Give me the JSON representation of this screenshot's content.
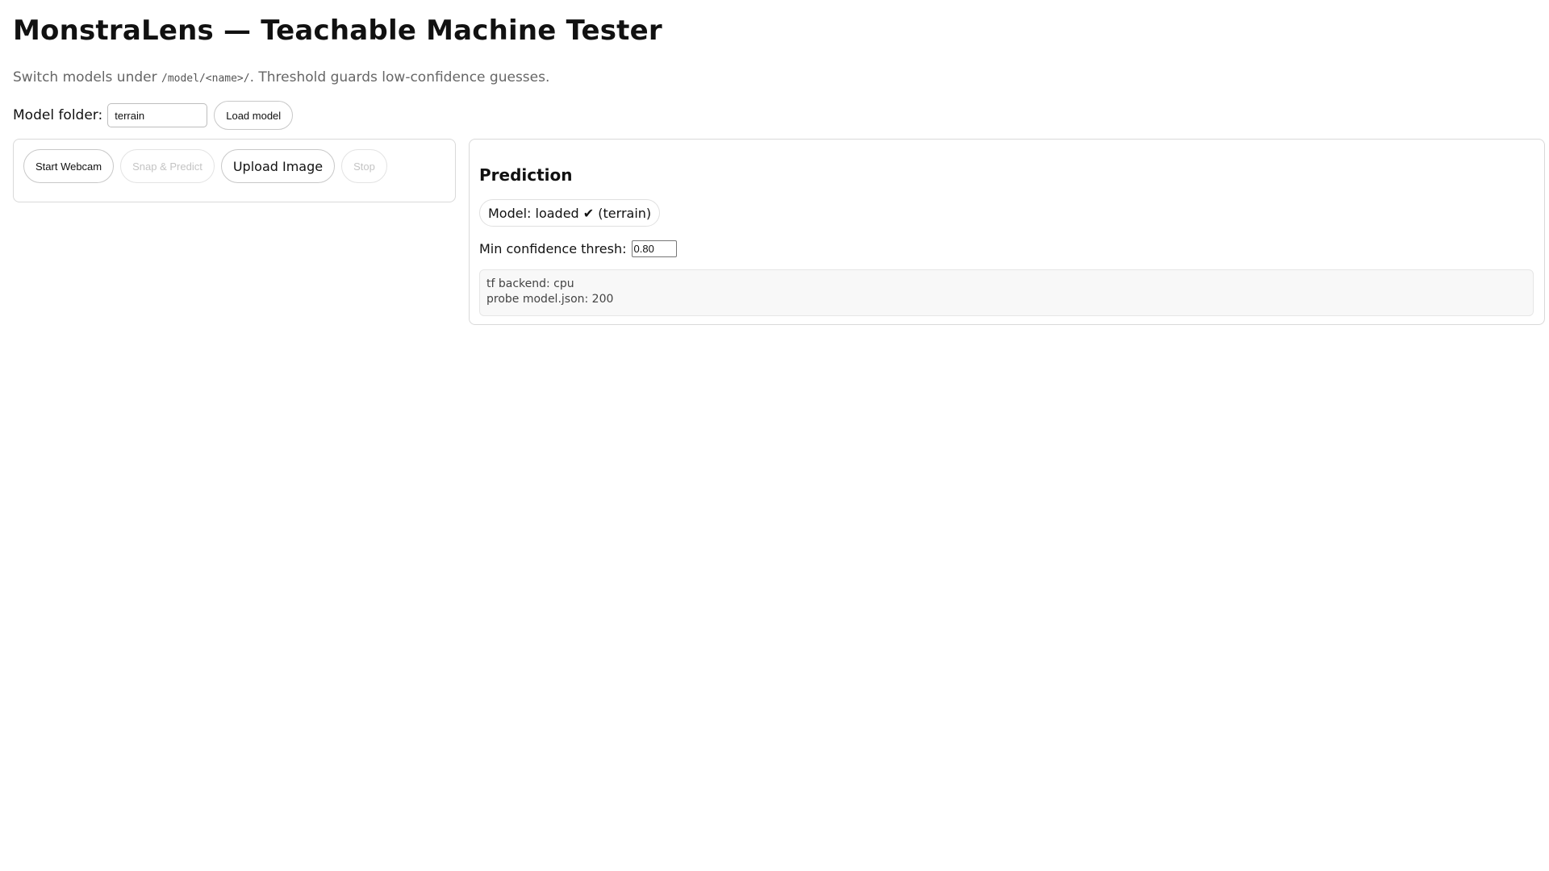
{
  "header": {
    "title": "MonstraLens — Teachable Machine Tester",
    "subtitle_before": "Switch models under ",
    "subtitle_code": "/model/<name>/",
    "subtitle_after": ". Threshold guards low-confidence guesses."
  },
  "model_folder": {
    "label": "Model folder:",
    "value": "terrain",
    "load_button": "Load model"
  },
  "capture": {
    "buttons": [
      {
        "label": "Start Webcam",
        "enabled": true
      },
      {
        "label": "Snap & Predict",
        "enabled": false
      },
      {
        "label": "Upload Image",
        "enabled": true
      },
      {
        "label": "Stop",
        "enabled": false
      }
    ]
  },
  "prediction": {
    "title": "Prediction",
    "status": "Model: loaded ✔ (terrain)",
    "threshold_label": "Min confidence thresh:",
    "threshold_value": "0.80",
    "log": [
      "tf backend: cpu",
      "probe model.json: 200"
    ]
  }
}
